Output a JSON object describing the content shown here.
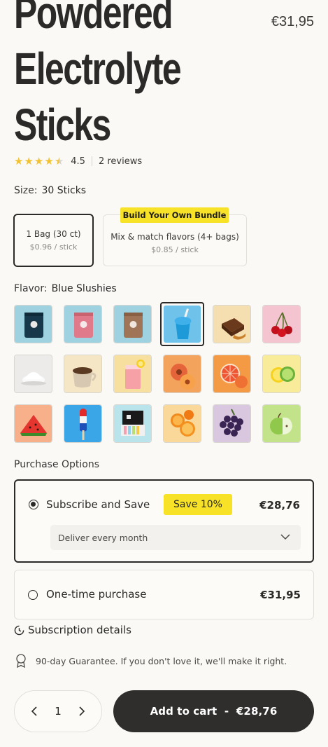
{
  "product": {
    "title_lines": [
      "Powdered",
      "Electrolyte",
      "Sticks"
    ],
    "price": "€31,95",
    "rating": {
      "stars": 4.5,
      "value": "4.5",
      "reviews": "2 reviews"
    }
  },
  "size": {
    "label": "Size:",
    "selected": "30 Sticks",
    "options": [
      {
        "title": "1 Bag (30 ct)",
        "sub": "$0.96 / stick"
      },
      {
        "title": "Mix & match flavors (4+ bags)",
        "sub": "$0.85 / stick",
        "badge": "Build Your Own Bundle"
      }
    ]
  },
  "flavor": {
    "label": "Flavor:",
    "selected": "Blue Slushies",
    "swatches": [
      "dark-pouch",
      "pink-pouch",
      "brown-pouch",
      "blue-slushie",
      "chocolate",
      "cherries",
      "white-powder",
      "coffee-cup",
      "pink-lemonade",
      "peach",
      "grapefruit",
      "lemon-lime",
      "watermelon",
      "rocket-popsicle",
      "variety-box",
      "orange",
      "grapes",
      "green-apple"
    ]
  },
  "purchase": {
    "label": "Purchase Options",
    "subscribe": {
      "label": "Subscribe and Save",
      "badge": "Save 10%",
      "price": "€28,76",
      "delivery": "Deliver every month"
    },
    "onetime": {
      "label": "One-time purchase",
      "price": "€31,95"
    },
    "details_link": "Subscription details",
    "guarantee": "90-day Guarantee. If you don't love it, we'll make it right."
  },
  "cart": {
    "quantity": "1",
    "button_label": "Add to cart  -  €28,76"
  },
  "colors": {
    "accent": "#f7e227",
    "dark": "#2f2e2c",
    "background": "#faf9f6",
    "star": "#f2c230"
  }
}
